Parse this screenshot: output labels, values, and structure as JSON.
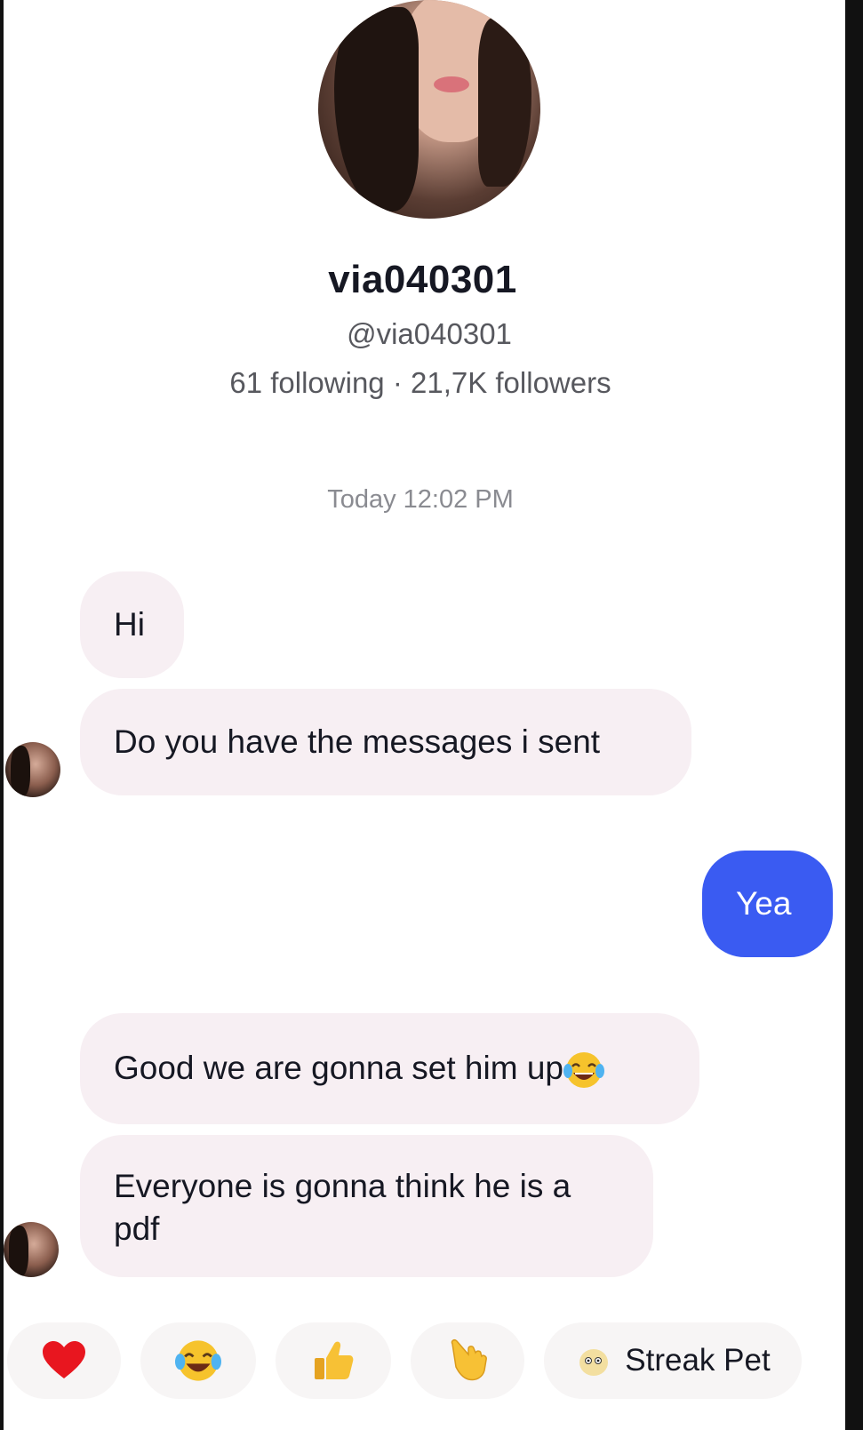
{
  "profile": {
    "display_name": "via040301",
    "username": "@via040301",
    "stats": "61 following · 21,7K followers"
  },
  "chat": {
    "timestamp": "Today 12:02 PM",
    "messages": [
      {
        "text": "Hi"
      },
      {
        "text": "Do you have the messages i sent"
      },
      {
        "text": "Yea"
      },
      {
        "text": "Good we are gonna set him up"
      },
      {
        "text": "Everyone is gonna think he is a pdf"
      }
    ]
  },
  "colors": {
    "outgoing_bubble": "#3a5bf2",
    "incoming_bubble": "#f7eff3"
  },
  "quick_reactions": [
    {
      "icon": "heart-icon"
    },
    {
      "icon": "tears-of-joy-icon"
    },
    {
      "icon": "thumbs-up-icon"
    },
    {
      "icon": "pointing-hand-icon"
    },
    {
      "icon": "streak-pet-icon",
      "label": "Streak Pet"
    }
  ]
}
